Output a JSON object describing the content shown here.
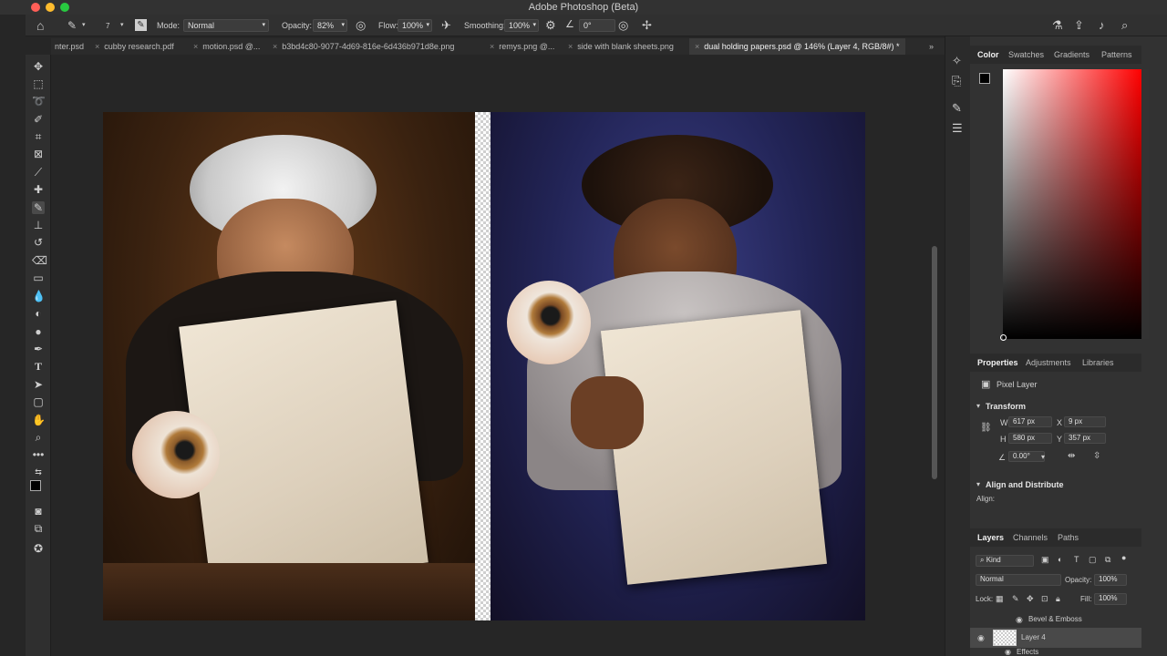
{
  "window": {
    "title": "Adobe Photoshop (Beta)",
    "traffic_colors": [
      "#ff5f57",
      "#febc2e",
      "#28c840"
    ]
  },
  "options": {
    "brush_size": "7",
    "mode_label": "Mode:",
    "mode_value": "Normal",
    "opacity_label": "Opacity:",
    "opacity_value": "82%",
    "flow_label": "Flow:",
    "flow_value": "100%",
    "smoothing_label": "Smoothing:",
    "smoothing_value": "100%",
    "angle_value": "0°"
  },
  "tabs": [
    "nter.psd",
    "cubby research.pdf",
    "motion.psd @...",
    "b3bd4c80-9077-4d69-816e-6d436b971d8e.png",
    "remys.png @...",
    "side with blank sheets.png",
    "dual holding papers.psd @ 146% (Layer 4, RGB/8#) *"
  ],
  "color_panel": {
    "tabs": [
      "Color",
      "Swatches",
      "Gradients",
      "Patterns"
    ],
    "active": "Color",
    "foreground": "#000000",
    "background": "#ffffff",
    "hue": "#ff0000"
  },
  "properties": {
    "tabs": [
      "Properties",
      "Adjustments",
      "Libraries"
    ],
    "layer_type": "Pixel Layer",
    "transform_title": "Transform",
    "w_label": "W",
    "w_value": "617 px",
    "h_label": "H",
    "h_value": "580 px",
    "x_label": "X",
    "x_value": "9 px",
    "y_label": "Y",
    "y_value": "357 px",
    "angle_value": "0.00°",
    "align_title": "Align and Distribute",
    "align_label": "Align:"
  },
  "layers": {
    "tabs": [
      "Layers",
      "Channels",
      "Paths"
    ],
    "filter": "Kind",
    "blend": "Normal",
    "opacity_label": "Opacity:",
    "opacity_value": "100%",
    "lock_label": "Lock:",
    "fill_label": "Fill:",
    "fill_value": "100%",
    "effect_name": "Bevel & Emboss",
    "layer_name": "Layer 4",
    "effects_label": "Effects"
  }
}
